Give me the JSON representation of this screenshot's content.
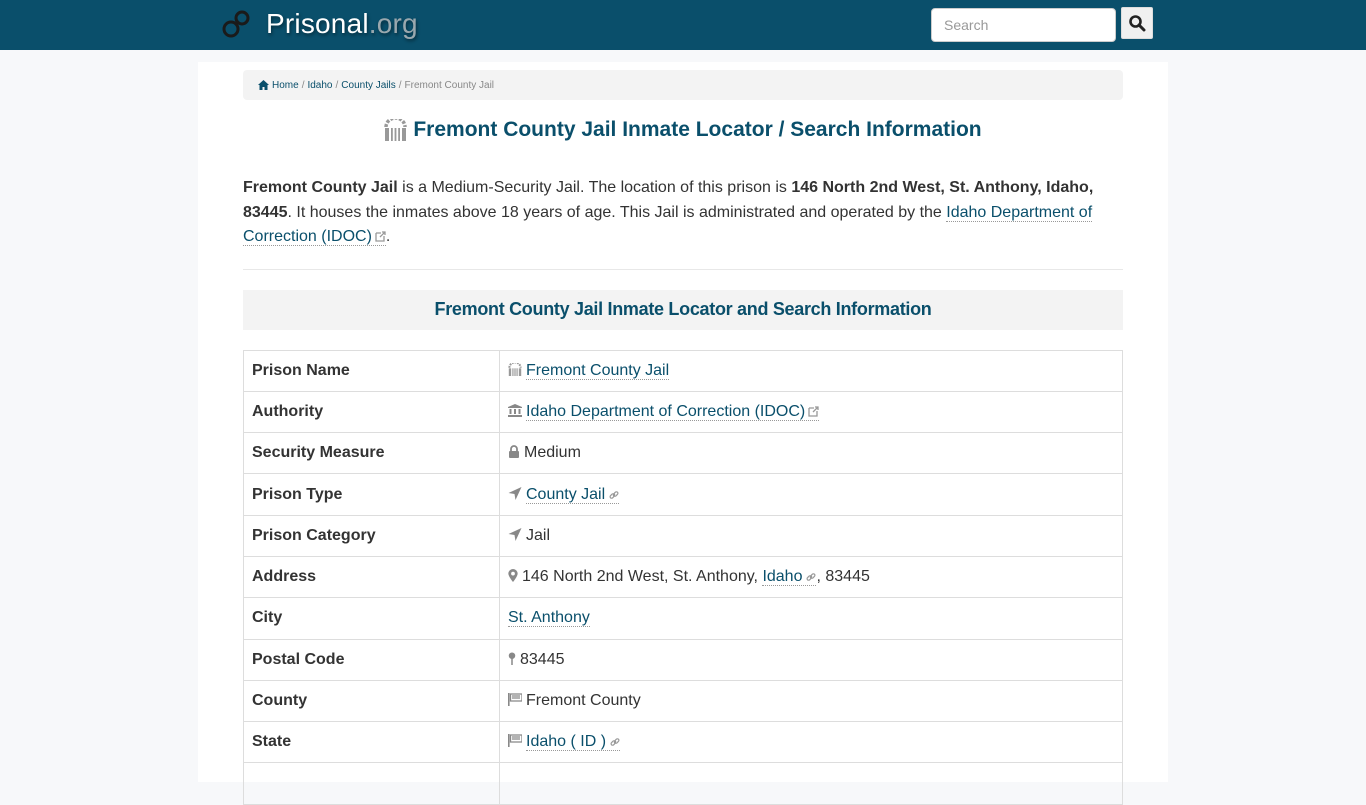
{
  "header": {
    "brand_name": "Prisonal",
    "brand_tld": ".org",
    "search_placeholder": "Search",
    "search_value": ""
  },
  "colors": {
    "primary": "#0a4f6b",
    "icon_gray": "#888888"
  },
  "breadcrumb": {
    "home": "Home",
    "state": "Idaho",
    "category": "County Jails",
    "current": "Fremont County Jail",
    "separator": "/"
  },
  "page_title": "Fremont County Jail Inmate Locator / Search Information",
  "intro": {
    "name": "Fremont County Jail",
    "text1": " is a Medium-Security Jail. The location of this prison is ",
    "address": "146 North 2nd West, St. Anthony, Idaho, 83445",
    "text2": ". It houses the inmates above 18 years of age. This Jail is administrated and operated by the ",
    "authority_link": "Idaho Department of Correction (IDOC)",
    "text3": "."
  },
  "section_title": "Fremont County Jail Inmate Locator and Search Information",
  "table": {
    "rows": [
      {
        "label": "Prison Name",
        "value": "Fremont County Jail",
        "icon": "jail-icon"
      },
      {
        "label": "Authority",
        "value": "Idaho Department of Correction (IDOC)",
        "icon": "bank-icon"
      },
      {
        "label": "Security Measure",
        "value": "Medium",
        "icon": "lock-icon"
      },
      {
        "label": "Prison Type",
        "value": "County Jail",
        "icon": "location-arrow-icon"
      },
      {
        "label": "Prison Category",
        "value": "Jail",
        "icon": "location-arrow-icon"
      },
      {
        "label": "Address",
        "value_prefix": "146 North 2nd West, St. Anthony, ",
        "value_link": "Idaho",
        "value_suffix": ", 83445",
        "icon": "map-marker-icon"
      },
      {
        "label": "City",
        "value": "St. Anthony"
      },
      {
        "label": "Postal Code",
        "value": "83445",
        "icon": "map-pin-icon"
      },
      {
        "label": "County",
        "value": "Fremont County",
        "icon": "flag-icon"
      },
      {
        "label": "State",
        "value": "Idaho ( ID )",
        "icon": "flag-icon"
      }
    ]
  }
}
